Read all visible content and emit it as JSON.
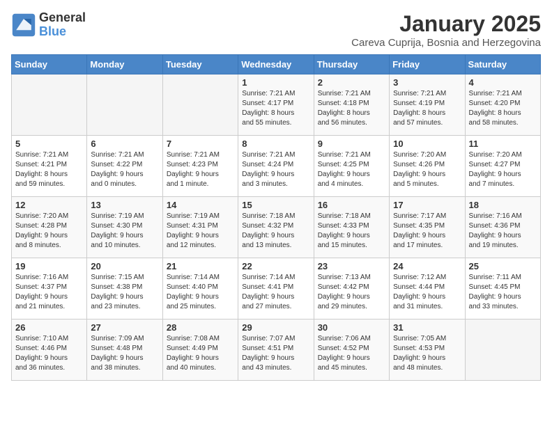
{
  "logo": {
    "general": "General",
    "blue": "Blue"
  },
  "header": {
    "month": "January 2025",
    "location": "Careva Cuprija, Bosnia and Herzegovina"
  },
  "weekdays": [
    "Sunday",
    "Monday",
    "Tuesday",
    "Wednesday",
    "Thursday",
    "Friday",
    "Saturday"
  ],
  "weeks": [
    [
      {
        "day": "",
        "info": ""
      },
      {
        "day": "",
        "info": ""
      },
      {
        "day": "",
        "info": ""
      },
      {
        "day": "1",
        "info": "Sunrise: 7:21 AM\nSunset: 4:17 PM\nDaylight: 8 hours\nand 55 minutes."
      },
      {
        "day": "2",
        "info": "Sunrise: 7:21 AM\nSunset: 4:18 PM\nDaylight: 8 hours\nand 56 minutes."
      },
      {
        "day": "3",
        "info": "Sunrise: 7:21 AM\nSunset: 4:19 PM\nDaylight: 8 hours\nand 57 minutes."
      },
      {
        "day": "4",
        "info": "Sunrise: 7:21 AM\nSunset: 4:20 PM\nDaylight: 8 hours\nand 58 minutes."
      }
    ],
    [
      {
        "day": "5",
        "info": "Sunrise: 7:21 AM\nSunset: 4:21 PM\nDaylight: 8 hours\nand 59 minutes."
      },
      {
        "day": "6",
        "info": "Sunrise: 7:21 AM\nSunset: 4:22 PM\nDaylight: 9 hours\nand 0 minutes."
      },
      {
        "day": "7",
        "info": "Sunrise: 7:21 AM\nSunset: 4:23 PM\nDaylight: 9 hours\nand 1 minute."
      },
      {
        "day": "8",
        "info": "Sunrise: 7:21 AM\nSunset: 4:24 PM\nDaylight: 9 hours\nand 3 minutes."
      },
      {
        "day": "9",
        "info": "Sunrise: 7:21 AM\nSunset: 4:25 PM\nDaylight: 9 hours\nand 4 minutes."
      },
      {
        "day": "10",
        "info": "Sunrise: 7:20 AM\nSunset: 4:26 PM\nDaylight: 9 hours\nand 5 minutes."
      },
      {
        "day": "11",
        "info": "Sunrise: 7:20 AM\nSunset: 4:27 PM\nDaylight: 9 hours\nand 7 minutes."
      }
    ],
    [
      {
        "day": "12",
        "info": "Sunrise: 7:20 AM\nSunset: 4:28 PM\nDaylight: 9 hours\nand 8 minutes."
      },
      {
        "day": "13",
        "info": "Sunrise: 7:19 AM\nSunset: 4:30 PM\nDaylight: 9 hours\nand 10 minutes."
      },
      {
        "day": "14",
        "info": "Sunrise: 7:19 AM\nSunset: 4:31 PM\nDaylight: 9 hours\nand 12 minutes."
      },
      {
        "day": "15",
        "info": "Sunrise: 7:18 AM\nSunset: 4:32 PM\nDaylight: 9 hours\nand 13 minutes."
      },
      {
        "day": "16",
        "info": "Sunrise: 7:18 AM\nSunset: 4:33 PM\nDaylight: 9 hours\nand 15 minutes."
      },
      {
        "day": "17",
        "info": "Sunrise: 7:17 AM\nSunset: 4:35 PM\nDaylight: 9 hours\nand 17 minutes."
      },
      {
        "day": "18",
        "info": "Sunrise: 7:16 AM\nSunset: 4:36 PM\nDaylight: 9 hours\nand 19 minutes."
      }
    ],
    [
      {
        "day": "19",
        "info": "Sunrise: 7:16 AM\nSunset: 4:37 PM\nDaylight: 9 hours\nand 21 minutes."
      },
      {
        "day": "20",
        "info": "Sunrise: 7:15 AM\nSunset: 4:38 PM\nDaylight: 9 hours\nand 23 minutes."
      },
      {
        "day": "21",
        "info": "Sunrise: 7:14 AM\nSunset: 4:40 PM\nDaylight: 9 hours\nand 25 minutes."
      },
      {
        "day": "22",
        "info": "Sunrise: 7:14 AM\nSunset: 4:41 PM\nDaylight: 9 hours\nand 27 minutes."
      },
      {
        "day": "23",
        "info": "Sunrise: 7:13 AM\nSunset: 4:42 PM\nDaylight: 9 hours\nand 29 minutes."
      },
      {
        "day": "24",
        "info": "Sunrise: 7:12 AM\nSunset: 4:44 PM\nDaylight: 9 hours\nand 31 minutes."
      },
      {
        "day": "25",
        "info": "Sunrise: 7:11 AM\nSunset: 4:45 PM\nDaylight: 9 hours\nand 33 minutes."
      }
    ],
    [
      {
        "day": "26",
        "info": "Sunrise: 7:10 AM\nSunset: 4:46 PM\nDaylight: 9 hours\nand 36 minutes."
      },
      {
        "day": "27",
        "info": "Sunrise: 7:09 AM\nSunset: 4:48 PM\nDaylight: 9 hours\nand 38 minutes."
      },
      {
        "day": "28",
        "info": "Sunrise: 7:08 AM\nSunset: 4:49 PM\nDaylight: 9 hours\nand 40 minutes."
      },
      {
        "day": "29",
        "info": "Sunrise: 7:07 AM\nSunset: 4:51 PM\nDaylight: 9 hours\nand 43 minutes."
      },
      {
        "day": "30",
        "info": "Sunrise: 7:06 AM\nSunset: 4:52 PM\nDaylight: 9 hours\nand 45 minutes."
      },
      {
        "day": "31",
        "info": "Sunrise: 7:05 AM\nSunset: 4:53 PM\nDaylight: 9 hours\nand 48 minutes."
      },
      {
        "day": "",
        "info": ""
      }
    ]
  ]
}
